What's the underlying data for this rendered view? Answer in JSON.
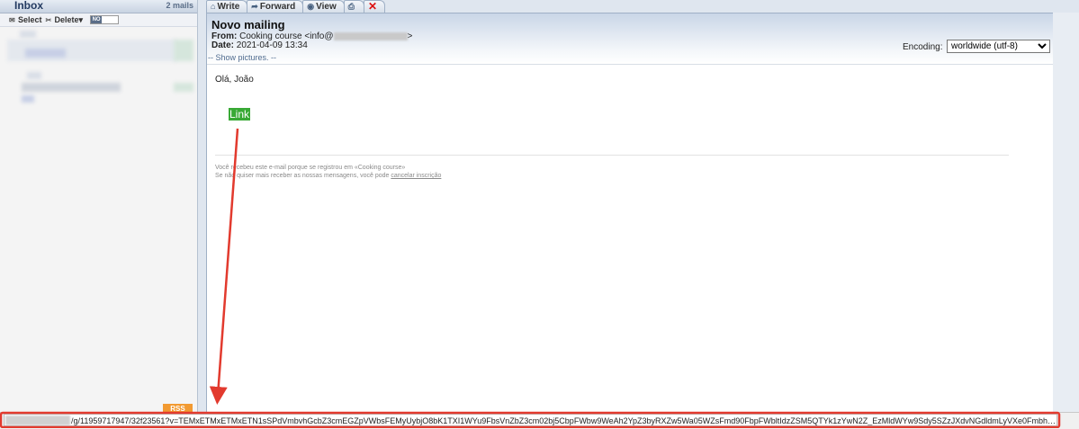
{
  "inbox": {
    "title": "Inbox",
    "count": "2 mails",
    "toolbar": {
      "select_label": "Select",
      "delete_label": "Delete",
      "toggle_label": "NO"
    },
    "rss_label": "RSS"
  },
  "tabs": [
    {
      "label": "Write",
      "icon": "house-icon"
    },
    {
      "label": "Forward",
      "icon": "forward-icon"
    },
    {
      "label": "View",
      "icon": "eye-icon"
    },
    {
      "label": "",
      "icon": "print-icon"
    },
    {
      "label": "",
      "icon": "close-icon"
    }
  ],
  "message": {
    "subject": "Novo mailing",
    "from_label": "From:",
    "from_value": "Cooking course <info@",
    "from_close": ">",
    "date_label": "Date:",
    "date_value": "2021-04-09 13:34",
    "show_pictures": "-- Show pictures. --",
    "encoding_label": "Encoding:",
    "encoding_value": "worldwide (utf-8)",
    "greeting": "Olá, João",
    "link_label": "Link",
    "footer_line1": "Você recebeu este e-mail porque se registrou em «Cooking course»",
    "footer_line2": "Se não quiser mais receber as nossas mensagens, você pode",
    "unsubscribe_label": "cancelar inscrição"
  },
  "statusbar": {
    "url": "/g/11959717947/32f23561?v=TEMxETMxETMxETN1sSPdVmbvhGcbZ3cmEGZpVWbsFEMyUybjO8bK1TXI1WYu9FbsVnZbZ3cm02bj5CbpFWbw9WeAh2YpZ3byRXZw5Wa05WZsFmd90FbpFWbltIdzZSM5QTYk1zYwN2Z_EzMldWYw9Sdy5SZzJXdvNGdldmLyVXe0Fmbh9yL6MHc0R..."
  },
  "colors": {
    "link_bg": "#38a935",
    "annotation": "#e23a2e",
    "rss": "#f29a31"
  }
}
